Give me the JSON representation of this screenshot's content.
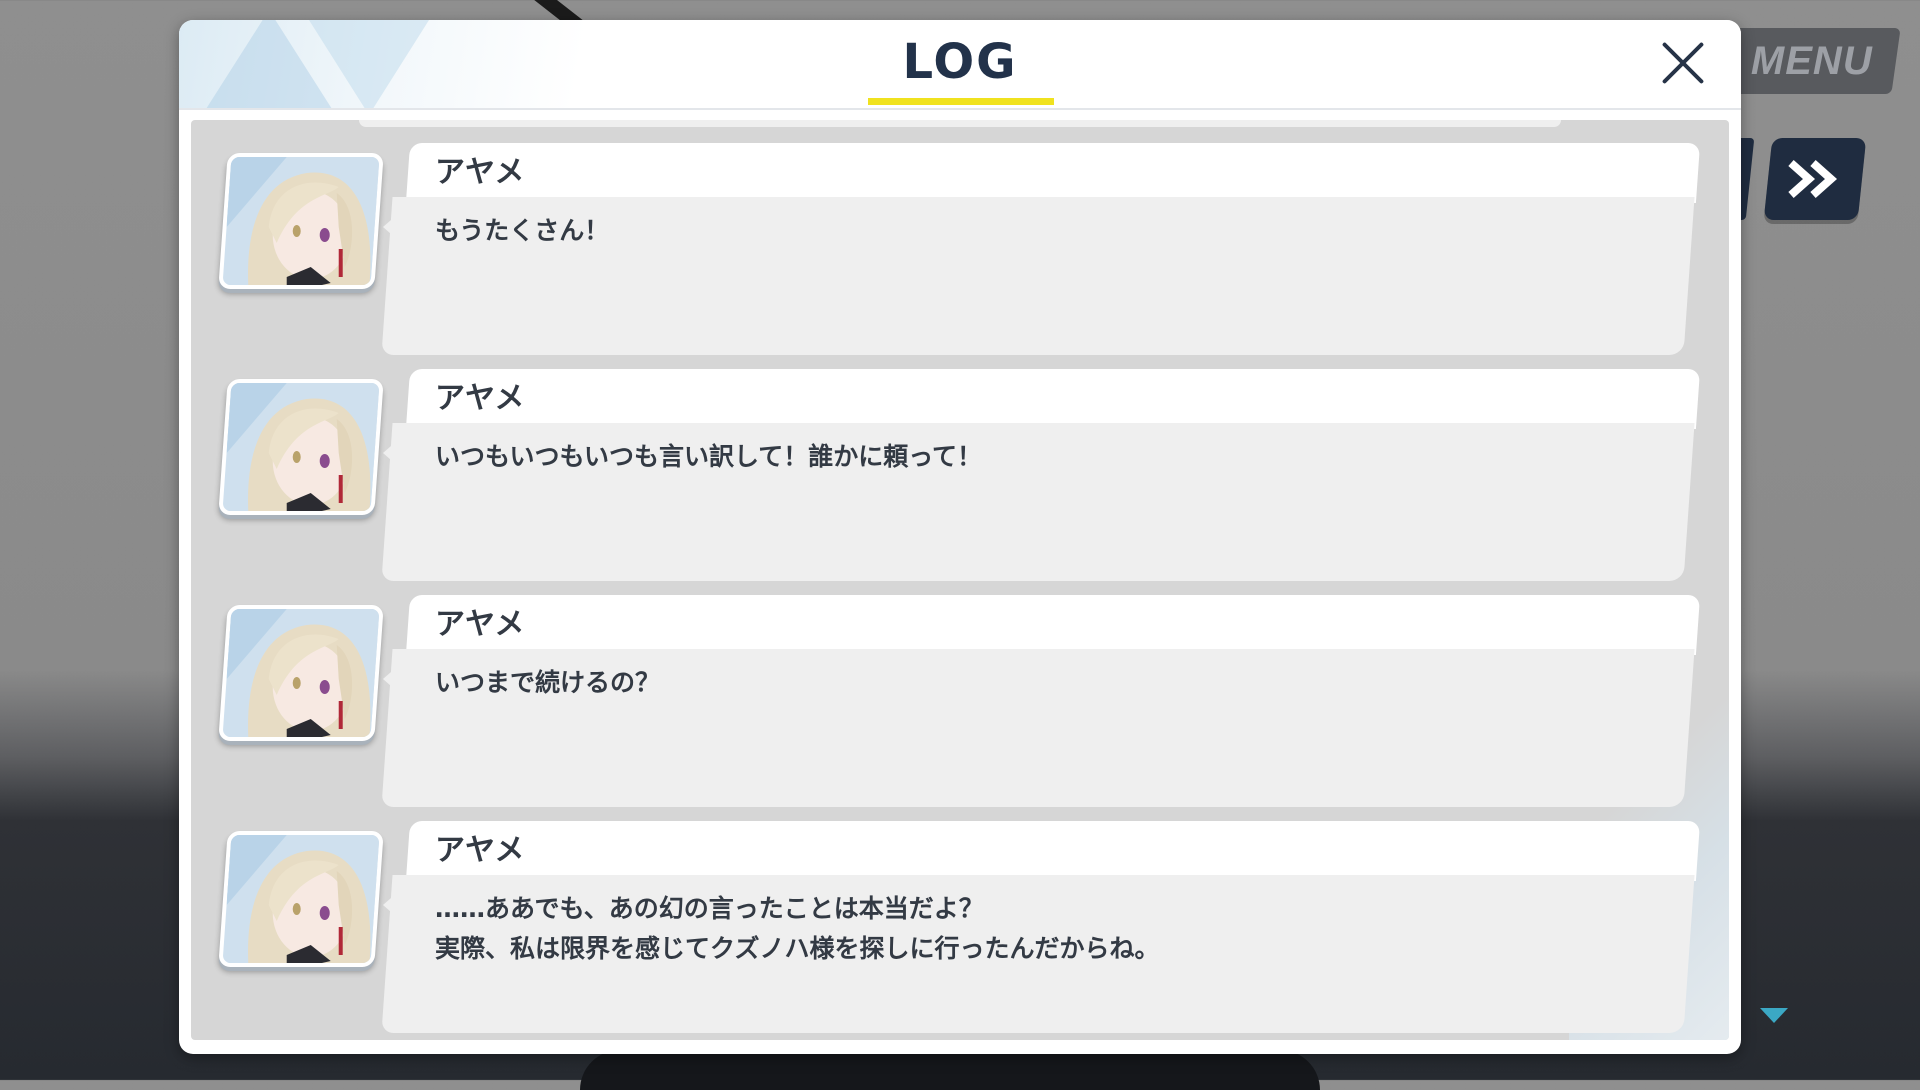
{
  "menu": {
    "label": "MENU"
  },
  "log": {
    "title": "LOG",
    "entries": [
      {
        "speaker": "アヤメ",
        "text": "もうたくさん！"
      },
      {
        "speaker": "アヤメ",
        "text": "いつもいつもいつも言い訳して！誰かに頼って！"
      },
      {
        "speaker": "アヤメ",
        "text": "いつまで続けるの？"
      },
      {
        "speaker": "アヤメ",
        "text": "……ああでも、あの幻の言ったことは本当だよ？\n実際、私は限界を感じてクズノハ様を探しに行ったんだからね。"
      }
    ]
  },
  "colors": {
    "title_underline": "#f0e21f",
    "title_text": "#22324a",
    "skip_button": "#1f2c40",
    "scroll_indicator": "#3ba8c4"
  }
}
